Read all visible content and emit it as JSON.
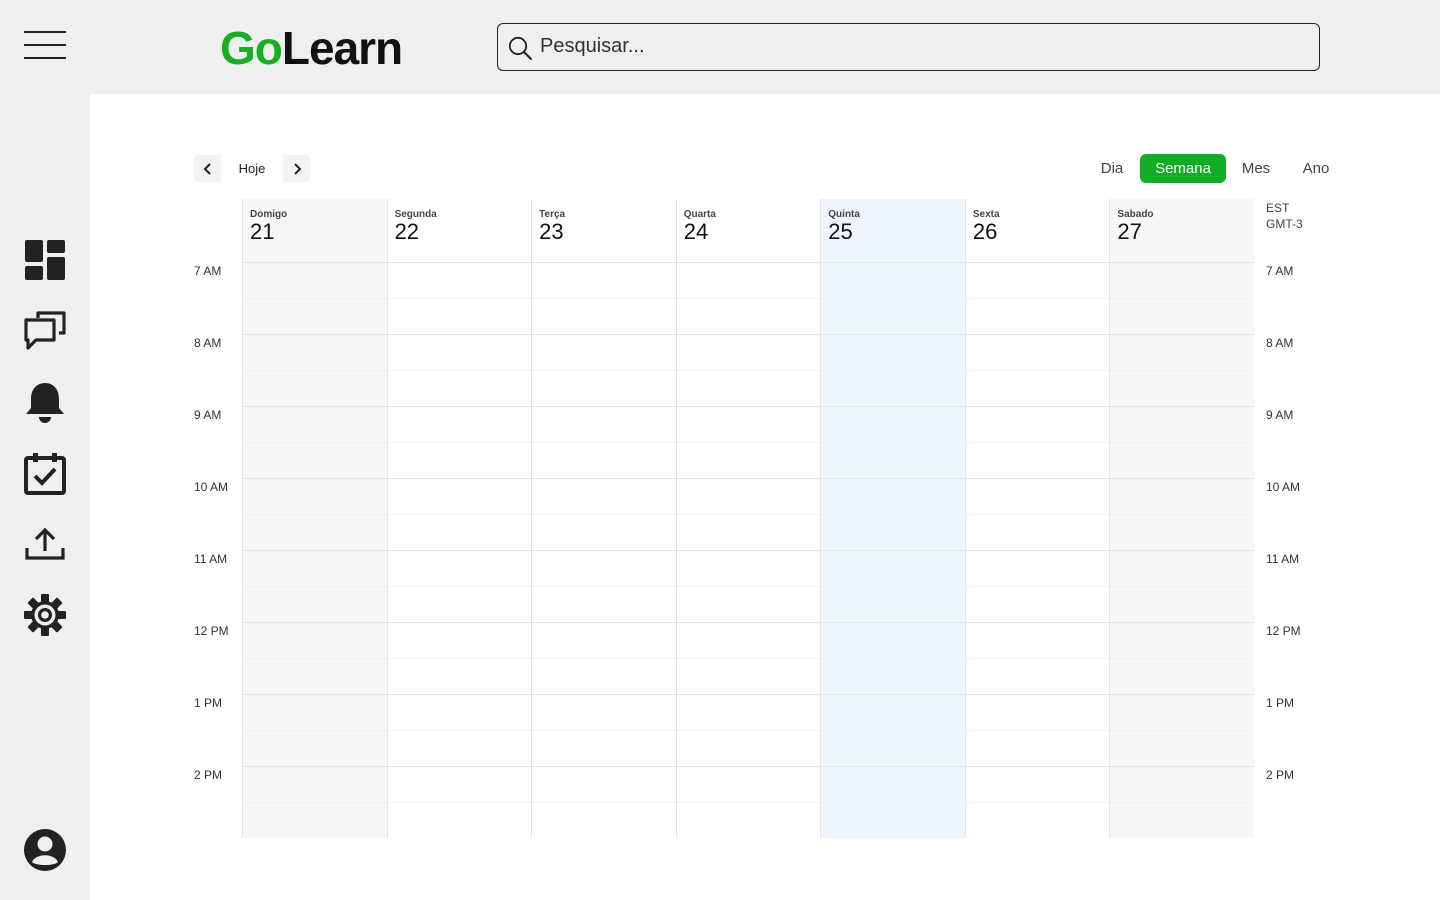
{
  "header": {
    "logo": {
      "part1": "Go",
      "part2": "Learn"
    },
    "search": {
      "placeholder": "Pesquisar..."
    }
  },
  "sidebar": {
    "items": [
      {
        "name": "dashboard-icon"
      },
      {
        "name": "chat-icon"
      },
      {
        "name": "bell-icon"
      },
      {
        "name": "calendar-check-icon"
      },
      {
        "name": "upload-icon"
      },
      {
        "name": "settings-icon"
      }
    ],
    "profile": {
      "name": "user-icon"
    }
  },
  "calendar": {
    "today_label": "Hoje",
    "views": [
      {
        "label": "Dia",
        "active": false
      },
      {
        "label": "Semana",
        "active": true
      },
      {
        "label": "Mes",
        "active": false
      },
      {
        "label": "Ano",
        "active": false
      }
    ],
    "days": [
      {
        "name": "Domigo",
        "num": "21",
        "weekend": true
      },
      {
        "name": "Segunda",
        "num": "22"
      },
      {
        "name": "Terça",
        "num": "23"
      },
      {
        "name": "Quarta",
        "num": "24"
      },
      {
        "name": "Quinta",
        "num": "25",
        "today": true
      },
      {
        "name": "Sexta",
        "num": "26"
      },
      {
        "name": "Sabado",
        "num": "27",
        "weekend": true
      }
    ],
    "hours": [
      "7 AM",
      "8 AM",
      "9 AM",
      "10 AM",
      "11 AM",
      "12 PM",
      "1 PM",
      "2 PM"
    ],
    "timezone": {
      "name": "EST",
      "offset": "GMT-3"
    }
  },
  "colors": {
    "brand_green": "#1aae23",
    "active_view": "#12ad25",
    "today_column": "#eef5fe",
    "weekend_column": "#f7f7f7",
    "grid_line": "#e4e4e4",
    "grid_half_line": "#f1f1f1"
  }
}
